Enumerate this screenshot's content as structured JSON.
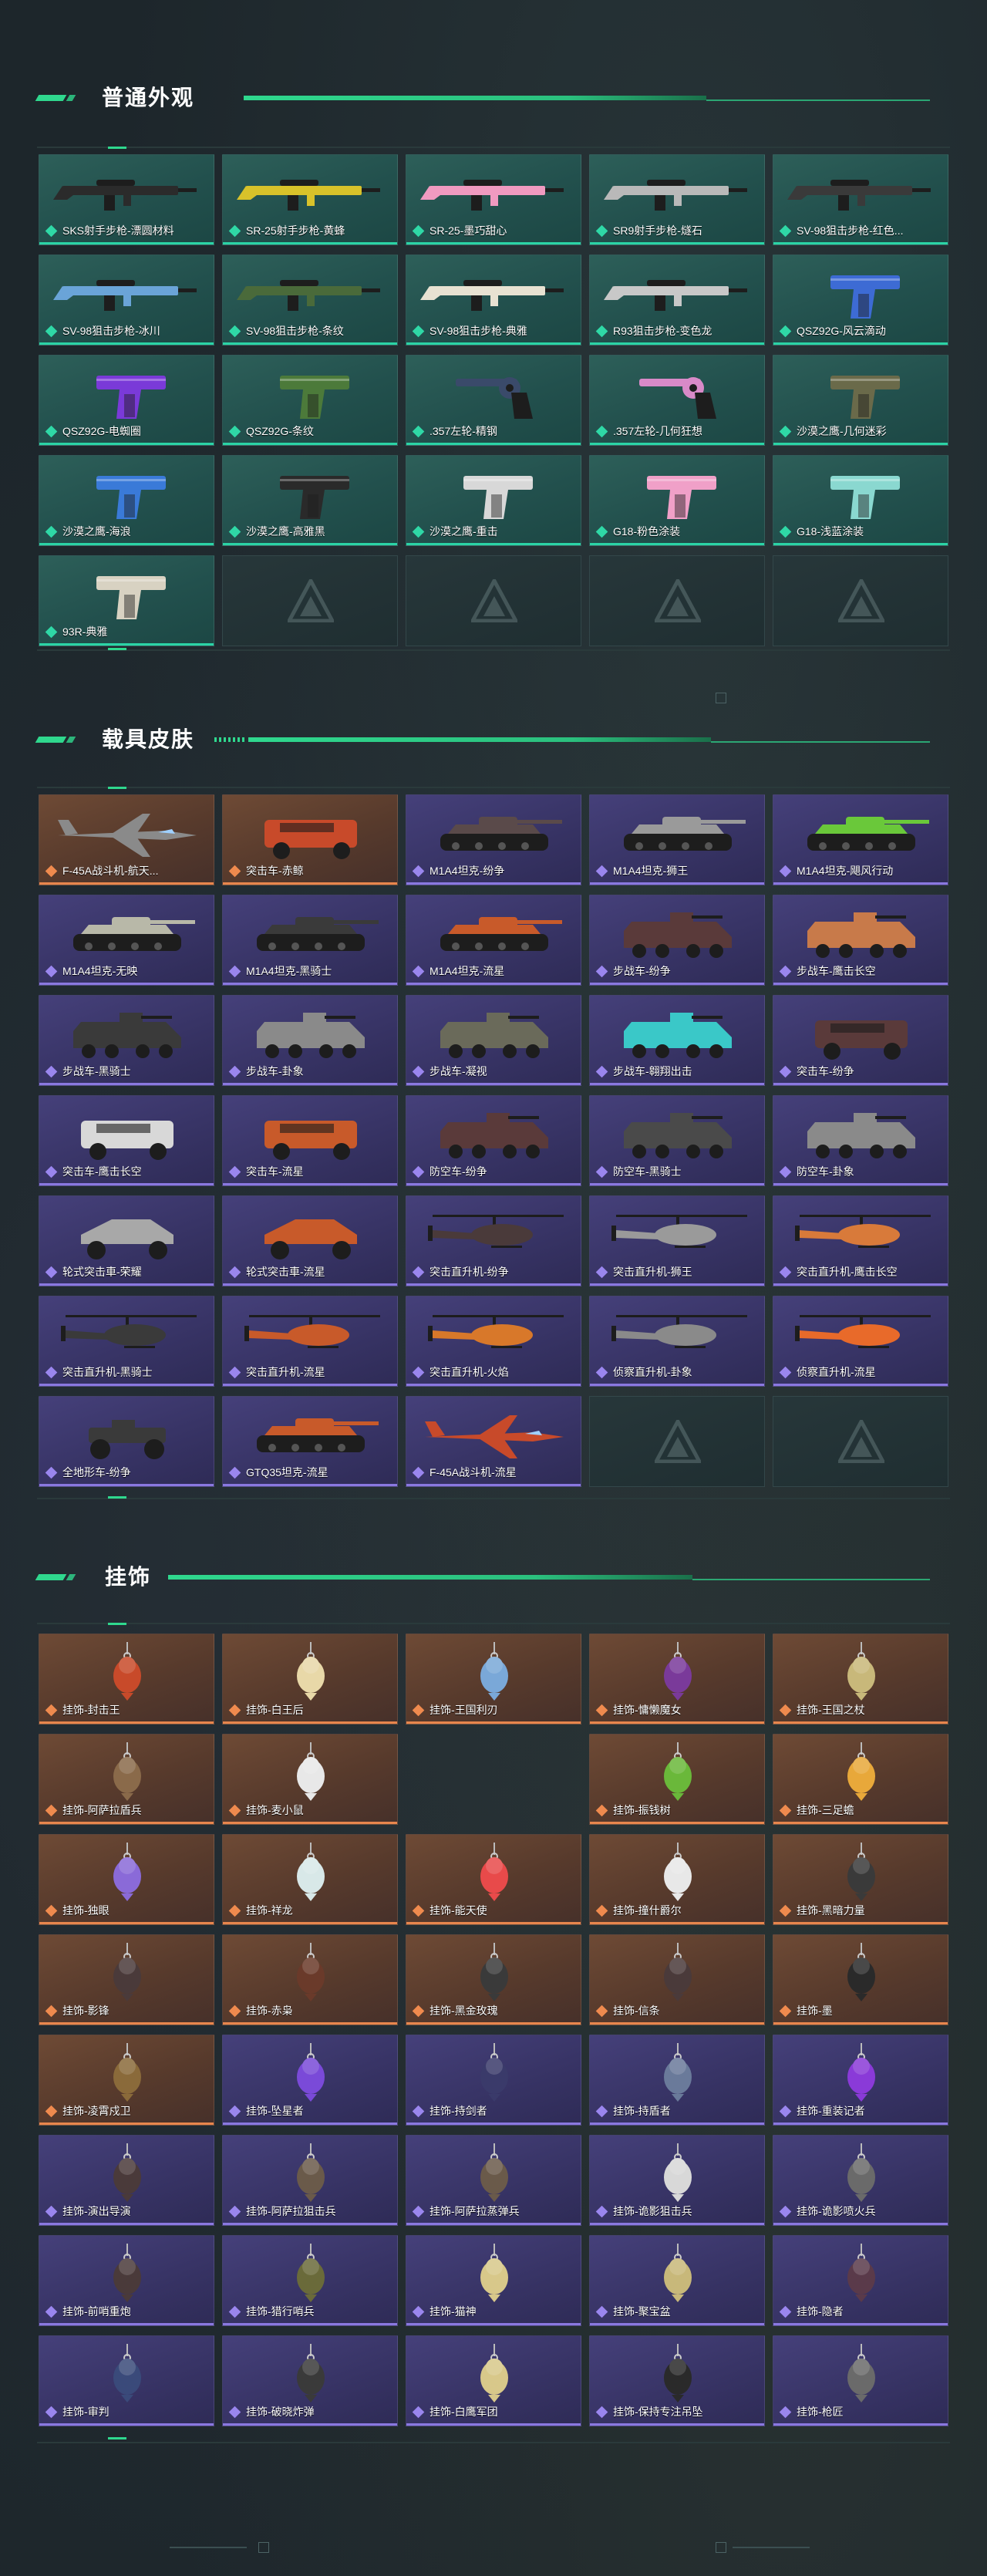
{
  "sections": {
    "weapons": {
      "title": "普通外观",
      "items": [
        {
          "label": "SKS射手步枪-漂圆材料",
          "rarity": "teal",
          "icon": "rifle-icon",
          "tint": "#2b2b2b"
        },
        {
          "label": "SR-25射手步枪-黄蜂",
          "rarity": "teal",
          "icon": "rifle-icon",
          "tint": "#d8c22a"
        },
        {
          "label": "SR-25-墨巧甜心",
          "rarity": "teal",
          "icon": "rifle-icon",
          "tint": "#f09ac0"
        },
        {
          "label": "SR9射手步枪-燧石",
          "rarity": "teal",
          "icon": "rifle-icon",
          "tint": "#b9b9b9"
        },
        {
          "label": "SV-98狙击步枪-红色...",
          "rarity": "teal",
          "icon": "rifle-icon",
          "tint": "#3a3a3a"
        },
        {
          "label": "SV-98狙击步枪-冰川",
          "rarity": "teal",
          "icon": "rifle-icon",
          "tint": "#6aa4d8"
        },
        {
          "label": "SV-98狙击步枪-条纹",
          "rarity": "teal",
          "icon": "rifle-icon",
          "tint": "#4a6a3a"
        },
        {
          "label": "SV-98狙击步枪-典雅",
          "rarity": "teal",
          "icon": "rifle-icon",
          "tint": "#e8e2d2"
        },
        {
          "label": "R93狙击步枪-变色龙",
          "rarity": "teal",
          "icon": "rifle-icon",
          "tint": "#c8c8c8"
        },
        {
          "label": "QSZ92G-风云滴动",
          "rarity": "teal",
          "icon": "pistol-icon",
          "tint": "#3d6bd4"
        },
        {
          "label": "QSZ92G-电蜘圈",
          "rarity": "teal",
          "icon": "pistol-icon",
          "tint": "#7a3ad8"
        },
        {
          "label": "QSZ92G-条纹",
          "rarity": "teal",
          "icon": "pistol-icon",
          "tint": "#4c7a3a"
        },
        {
          "label": ".357左轮-精钢",
          "rarity": "teal",
          "icon": "revolver-icon",
          "tint": "#3a4a6a"
        },
        {
          "label": ".357左轮-几何狂想",
          "rarity": "teal",
          "icon": "revolver-icon",
          "tint": "#d88ac8"
        },
        {
          "label": "沙漠之鹰-几何迷彩",
          "rarity": "teal",
          "icon": "pistol-icon",
          "tint": "#6a6a4a"
        },
        {
          "label": "沙漠之鹰-海浪",
          "rarity": "teal",
          "icon": "pistol-icon",
          "tint": "#3a7ad8"
        },
        {
          "label": "沙漠之鹰-高雅黑",
          "rarity": "teal",
          "icon": "pistol-icon",
          "tint": "#2a2a2a"
        },
        {
          "label": "沙漠之鹰-重击",
          "rarity": "teal",
          "icon": "pistol-icon",
          "tint": "#d8d8d8"
        },
        {
          "label": "G18-粉色涂装",
          "rarity": "teal",
          "icon": "pistol-icon",
          "tint": "#f0a0c8"
        },
        {
          "label": "G18-浅蓝涂装",
          "rarity": "teal",
          "icon": "pistol-icon",
          "tint": "#8ad8d0"
        },
        {
          "label": "93R-典雅",
          "rarity": "teal",
          "icon": "pistol-icon",
          "tint": "#d8d2c2"
        }
      ],
      "empty_count": 4
    },
    "vehicles": {
      "title": "载具皮肤",
      "items": [
        {
          "label": "F-45A战斗机-航天...",
          "rarity": "orange",
          "icon": "jet-icon",
          "tint": "#8a8a8a"
        },
        {
          "label": "突击车-赤鲸",
          "rarity": "orange",
          "icon": "suv-icon",
          "tint": "#c84a2a"
        },
        {
          "label": "M1A4坦克-纷争",
          "rarity": "purple",
          "icon": "tank-icon",
          "tint": "#5a4a4a"
        },
        {
          "label": "M1A4坦克-狮王",
          "rarity": "purple",
          "icon": "tank-icon",
          "tint": "#9a9a9a"
        },
        {
          "label": "M1A4坦克-飓风行动",
          "rarity": "purple",
          "icon": "tank-icon",
          "tint": "#6ac83a"
        },
        {
          "label": "M1A4坦克-无映",
          "rarity": "purple",
          "icon": "tank-icon",
          "tint": "#b8b8a8"
        },
        {
          "label": "M1A4坦克-黑骑士",
          "rarity": "purple",
          "icon": "tank-icon",
          "tint": "#3a3a3a"
        },
        {
          "label": "M1A4坦克-流星",
          "rarity": "purple",
          "icon": "tank-icon",
          "tint": "#c85a2a"
        },
        {
          "label": "步战车-纷争",
          "rarity": "purple",
          "icon": "apc-icon",
          "tint": "#5a3a3a"
        },
        {
          "label": "步战车-鹰击长空",
          "rarity": "purple",
          "icon": "apc-icon",
          "tint": "#c87a4a"
        },
        {
          "label": "步战车-黑骑士",
          "rarity": "purple",
          "icon": "apc-icon",
          "tint": "#3a3a3a"
        },
        {
          "label": "步战车-卦象",
          "rarity": "purple",
          "icon": "apc-icon",
          "tint": "#8a8a8a"
        },
        {
          "label": "步战车-凝视",
          "rarity": "purple",
          "icon": "apc-icon",
          "tint": "#6a6a5a"
        },
        {
          "label": "步战车-翱翔出击",
          "rarity": "purple",
          "icon": "apc-icon",
          "tint": "#3ac8c8"
        },
        {
          "label": "突击车-纷争",
          "rarity": "purple",
          "icon": "suv-icon",
          "tint": "#5a3a3a"
        },
        {
          "label": "突击车-鹰击长空",
          "rarity": "purple",
          "icon": "suv-icon",
          "tint": "#d8d8d8"
        },
        {
          "label": "突击车-流星",
          "rarity": "purple",
          "icon": "suv-icon",
          "tint": "#c85a2a"
        },
        {
          "label": "防空车-纷争",
          "rarity": "purple",
          "icon": "apc-icon",
          "tint": "#5a3a3a"
        },
        {
          "label": "防空车-黑骑士",
          "rarity": "purple",
          "icon": "apc-icon",
          "tint": "#4a4a4a"
        },
        {
          "label": "防空车-卦象",
          "rarity": "purple",
          "icon": "apc-icon",
          "tint": "#8a8a8a"
        },
        {
          "label": "轮式突击車-荣耀",
          "rarity": "purple",
          "icon": "buggy-icon",
          "tint": "#a8a8a8"
        },
        {
          "label": "轮式突击車-流星",
          "rarity": "purple",
          "icon": "buggy-icon",
          "tint": "#c85a2a"
        },
        {
          "label": "突击直升机-纷争",
          "rarity": "purple",
          "icon": "helicopter-icon",
          "tint": "#4a3a3a"
        },
        {
          "label": "突击直升机-狮王",
          "rarity": "purple",
          "icon": "helicopter-icon",
          "tint": "#9a9a9a"
        },
        {
          "label": "突击直升机-鹰击长空",
          "rarity": "purple",
          "icon": "helicopter-icon",
          "tint": "#d87a3a"
        },
        {
          "label": "突击直升机-黑骑士",
          "rarity": "purple",
          "icon": "helicopter-icon",
          "tint": "#3a3a3a"
        },
        {
          "label": "突击直升机-流星",
          "rarity": "purple",
          "icon": "helicopter-icon",
          "tint": "#c85a2a"
        },
        {
          "label": "突击直升机-火焰",
          "rarity": "purple",
          "icon": "helicopter-icon",
          "tint": "#d8782a"
        },
        {
          "label": "侦察直升机-卦象",
          "rarity": "purple",
          "icon": "helicopter-icon",
          "tint": "#8a8a8a"
        },
        {
          "label": "侦察直升机-流星",
          "rarity": "purple",
          "icon": "helicopter-icon",
          "tint": "#e86a2a"
        },
        {
          "label": "全地形车-纷争",
          "rarity": "purple",
          "icon": "atv-icon",
          "tint": "#3a3a3a"
        },
        {
          "label": "GTQ35坦克-流星",
          "rarity": "purple",
          "icon": "tank-icon",
          "tint": "#c85a2a"
        },
        {
          "label": "F-45A战斗机-流星",
          "rarity": "purple",
          "icon": "jet-icon",
          "tint": "#c84a2a"
        }
      ],
      "empty_count": 2
    },
    "charms": {
      "title": "挂饰",
      "rows": [
        [
          {
            "label": "挂饰-封击王",
            "rarity": "orange",
            "tint": "#c84a2a"
          },
          {
            "label": "挂饰-白王后",
            "rarity": "orange",
            "tint": "#e8d8a8"
          },
          {
            "label": "挂饰-王国利刃",
            "rarity": "orange",
            "tint": "#7aa8d8"
          },
          {
            "label": "挂饰-慵懒魔女",
            "rarity": "orange",
            "tint": "#7a3a9a"
          },
          {
            "label": "挂饰-王国之杖",
            "rarity": "orange",
            "tint": "#c8b87a"
          }
        ],
        [
          {
            "label": "挂饰-阿萨拉盾兵",
            "rarity": "orange",
            "tint": "#8a6a4a"
          },
          {
            "label": "挂饰-麦小鼠",
            "rarity": "orange",
            "tint": "#e8e8e8"
          },
          null,
          {
            "label": "挂饰-振钱树",
            "rarity": "orange",
            "tint": "#6ab83a"
          },
          {
            "label": "挂饰-三足蟾",
            "rarity": "orange",
            "tint": "#e8a83a"
          }
        ],
        [
          {
            "label": "挂饰-独眼",
            "rarity": "orange",
            "tint": "#8a6ad8"
          },
          {
            "label": "挂饰-祥龙",
            "rarity": "orange",
            "tint": "#d8e8e8"
          },
          {
            "label": "挂饰-能天使",
            "rarity": "orange",
            "tint": "#e84a4a"
          },
          {
            "label": "挂饰-撞什爵尔",
            "rarity": "orange",
            "tint": "#e8e8e8"
          },
          {
            "label": "挂饰-黑暗力量",
            "rarity": "orange",
            "tint": "#3a3a3a"
          }
        ],
        [
          {
            "label": "挂饰-影锋",
            "rarity": "orange",
            "tint": "#4a3a3a"
          },
          {
            "label": "挂饰-赤枭",
            "rarity": "orange",
            "tint": "#6a3a2a"
          },
          {
            "label": "挂饰-黑金玫瑰",
            "rarity": "orange",
            "tint": "#3a3a3a"
          },
          {
            "label": "挂饰-信条",
            "rarity": "orange",
            "tint": "#4a3a3a"
          },
          {
            "label": "挂饰-墨",
            "rarity": "orange",
            "tint": "#2a2a2a"
          }
        ],
        [
          {
            "label": "挂饰-凌霄戍卫",
            "rarity": "orange",
            "tint": "#8a6a3a"
          },
          {
            "label": "挂饰-坠星者",
            "rarity": "purple",
            "tint": "#7a4ad8"
          },
          {
            "label": "挂饰-持剑者",
            "rarity": "purple",
            "tint": "#3a3a6a"
          },
          {
            "label": "挂饰-持盾者",
            "rarity": "purple",
            "tint": "#6a7a9a"
          },
          {
            "label": "挂饰-重装记者",
            "rarity": "purple",
            "tint": "#8a3ad8"
          }
        ],
        [
          {
            "label": "挂饰-演出导演",
            "rarity": "purple",
            "tint": "#4a3a3a"
          },
          {
            "label": "挂饰-阿萨拉狙击兵",
            "rarity": "purple",
            "tint": "#6a5a4a"
          },
          {
            "label": "挂饰-阿萨拉蒸弹兵",
            "rarity": "purple",
            "tint": "#6a5a4a"
          },
          {
            "label": "挂饰-诡影狙击兵",
            "rarity": "purple",
            "tint": "#d8d8d8"
          },
          {
            "label": "挂饰-诡影喷火兵",
            "rarity": "purple",
            "tint": "#6a6a6a"
          }
        ],
        [
          {
            "label": "挂饰-前哨重炮",
            "rarity": "purple",
            "tint": "#4a3a3a"
          },
          {
            "label": "挂饰-猎行哨兵",
            "rarity": "purple",
            "tint": "#6a6a3a"
          },
          {
            "label": "挂饰-猫神",
            "rarity": "purple",
            "tint": "#d8c88a"
          },
          {
            "label": "挂饰-聚宝盆",
            "rarity": "purple",
            "tint": "#c8b87a"
          },
          {
            "label": "挂饰-隐者",
            "rarity": "purple",
            "tint": "#5a3a4a"
          }
        ],
        [
          {
            "label": "挂饰-审判",
            "rarity": "purple",
            "tint": "#3a4a7a"
          },
          {
            "label": "挂饰-破晓炸弹",
            "rarity": "purple",
            "tint": "#3a3a3a"
          },
          {
            "label": "挂饰-白鹰军团",
            "rarity": "purple",
            "tint": "#d8c88a"
          },
          {
            "label": "挂饰-保持专注吊坠",
            "rarity": "purple",
            "tint": "#2a2a2a"
          },
          {
            "label": "挂饰-枪匠",
            "rarity": "purple",
            "tint": "#6a6a6a"
          }
        ]
      ]
    }
  }
}
